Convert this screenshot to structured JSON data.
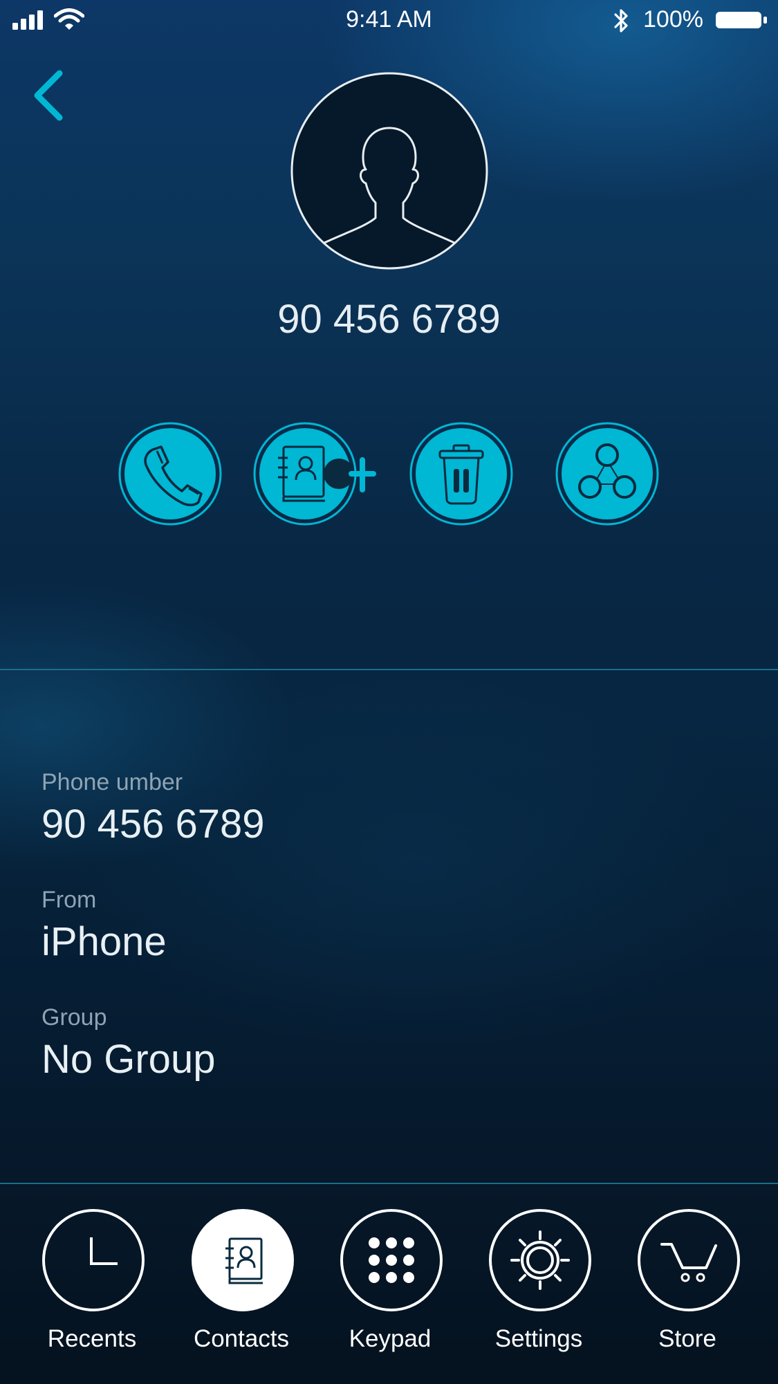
{
  "status_bar": {
    "time": "9:41 AM",
    "battery": "100%"
  },
  "contact": {
    "number": "90 456 6789"
  },
  "actions": [
    {
      "icon": "phone-icon"
    },
    {
      "icon": "add-contact-icon"
    },
    {
      "icon": "trash-icon"
    },
    {
      "icon": "share-icon"
    }
  ],
  "details": [
    {
      "label": "Phone umber",
      "value": "90 456 6789"
    },
    {
      "label": "From",
      "value": "iPhone"
    },
    {
      "label": "Group",
      "value": "No Group"
    }
  ],
  "tabs": [
    {
      "label": "Recents",
      "icon": "clock-icon",
      "active": false
    },
    {
      "label": "Contacts",
      "icon": "contacts-icon",
      "active": true
    },
    {
      "label": "Keypad",
      "icon": "keypad-icon",
      "active": false
    },
    {
      "label": "Settings",
      "icon": "settings-icon",
      "active": false
    },
    {
      "label": "Store",
      "icon": "cart-icon",
      "active": false
    }
  ],
  "colors": {
    "accent": "#00b7d4",
    "icon_dark": "#0a2a3f",
    "divider": "#1a6f8a",
    "label": "#8fa3b3"
  }
}
